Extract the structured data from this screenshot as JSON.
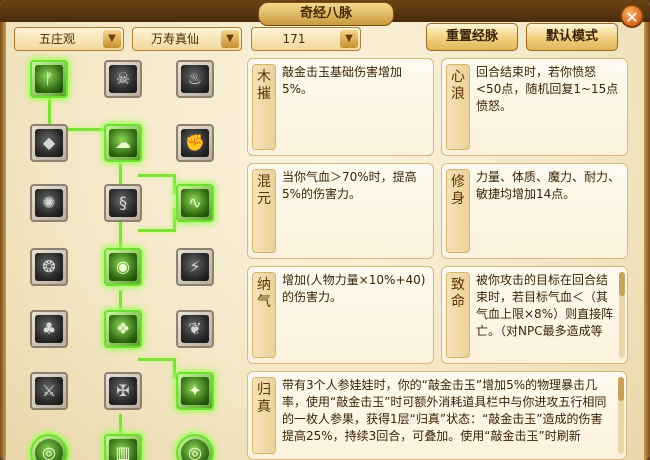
{
  "window": {
    "title": "奇经八脉"
  },
  "controls": {
    "dropdown1": "五庄观",
    "dropdown2": "万寿真仙",
    "dropdown3": "171",
    "reset_button": "重置经脉",
    "default_button": "默认模式"
  },
  "cards": [
    {
      "name1": "木",
      "name2": "摧",
      "text": "敲金击玉基础伤害增加5%。"
    },
    {
      "name1": "心",
      "name2": "浪",
      "text": "回合结束时，若你愤怒<50点，随机回复1~15点愤怒。"
    },
    {
      "name1": "混",
      "name2": "元",
      "text": "当你气血＞70%时，提高5%的伤害力。"
    },
    {
      "name1": "修",
      "name2": "身",
      "text": "力量、体质、魔力、耐力、敏捷均增加14点。"
    },
    {
      "name1": "纳",
      "name2": "气",
      "text": "增加(人物力量×10%+40)的伤害力。"
    },
    {
      "name1": "致",
      "name2": "命",
      "text": "被你攻击的目标在回合结束时，若目标气血＜（其气血上限×8%）则直接阵亡。（对NPC最多造成等"
    },
    {
      "name1": "归",
      "name2": "真",
      "text": "带有3个人参娃娃时，你的“敲金击玉”增加5%的物理暴击几率，使用“敲金击玉”时可额外消耗道具栏中与你进攻五行相同的一枚人参果，获得1层“归真”状态：“敲金击玉”造成的伤害提高25%，持续3回合，可叠加。使用“敲金击玉”时刷新"
    }
  ],
  "icons": [
    "tree-icon",
    "ghost-icon",
    "censer-icon",
    "rock-icon",
    "cloud-swirl-icon",
    "fist-icon",
    "wheel-icon",
    "spiral-icon",
    "snake-icon",
    "orbs-icon",
    "sun-disc-icon",
    "runner-icon",
    "bells-icon",
    "dragon-orb-icon",
    "leaf-sigil-icon",
    "blades-icon",
    "twist-icon",
    "warrior-icon",
    "orb-bottom-left-icon",
    "gate-bottom-icon",
    "orb-bottom-right-icon"
  ]
}
